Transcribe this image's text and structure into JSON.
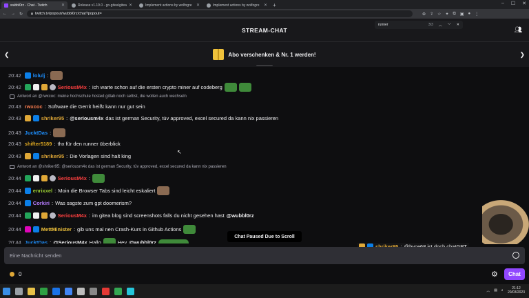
{
  "browser": {
    "tabs": [
      {
        "label": "wubbl0rz - Chat - Twitch",
        "active": true,
        "icon": "twitch-icon"
      },
      {
        "label": "Release v1.19.0 - go-gitea/gitea",
        "active": false,
        "icon": "github-icon"
      },
      {
        "label": "Implement actions by wolfogre",
        "active": false,
        "icon": "github-icon"
      },
      {
        "label": "Implement actions by wolfogre",
        "active": false,
        "icon": "github-icon"
      }
    ],
    "new_tab": "+",
    "url": "twitch.tv/popout/wubbl0rz/chat?popout=",
    "find": {
      "query": "runner",
      "count": "3/3"
    }
  },
  "header": {
    "title": "STREAM-CHAT"
  },
  "promo": {
    "label": "Abo verschenken & Nr. 1 werden!"
  },
  "chat": {
    "messages": [
      {
        "time": "20:42",
        "user": "lolulj",
        "color": "#1e90ff",
        "badges": [
          "b-prime"
        ],
        "text": "",
        "emotes": [
          "e-face"
        ]
      },
      {
        "time": "20:42",
        "user": "SeriousM4x",
        "color": "#ff4040",
        "badges": [
          "b-green",
          "b-crown",
          "b-sub",
          "b-moon"
        ],
        "text": "ich warte schon auf die ersten crypto miner auf codeberg",
        "emotes": [
          "e-frog",
          "e-frog"
        ]
      },
      {
        "reply": "Antwort an @rwxcoc: meine hochschule hosted gitlab noch selbst, die wollen auch wechseln"
      },
      {
        "time": "20:43",
        "user": "rwxcoc",
        "color": "#ff7f50",
        "badges": [],
        "text": "Software die Gerrit heißt kann nur gut sein"
      },
      {
        "time": "20:43",
        "user": "shriker95",
        "color": "#e0a837",
        "badges": [
          "b-sub",
          "b-prime"
        ],
        "text": "das ist german Security, tüv approved, excel secured da kann nix passieren",
        "mention": "@seriousm4x"
      },
      {
        "time": "20:43",
        "user": "JucktDas",
        "color": "#1e90ff",
        "badges": [],
        "text": "",
        "emotes": [
          "e-face"
        ]
      },
      {
        "time": "20:43",
        "user": "shifter5189",
        "color": "#daa520",
        "badges": [],
        "text": "thx für den runner überblick"
      },
      {
        "time": "20:43",
        "user": "shriker95",
        "color": "#e0a837",
        "badges": [
          "b-sub",
          "b-prime"
        ],
        "text": "Die Vorlagen sind halt king"
      },
      {
        "reply": "Antwort an @shriker95: @seriousm4x das ist german Security, tüv approved, excel secured da kann nix passieren"
      },
      {
        "time": "20:44",
        "user": "SeriousM4x",
        "color": "#ff4040",
        "badges": [
          "b-green",
          "b-crown",
          "b-sub",
          "b-moon"
        ],
        "text": "",
        "emotes": [
          "e-frog"
        ]
      },
      {
        "time": "20:44",
        "user": "enrixxel",
        "color": "#9acd32",
        "badges": [
          "b-prime"
        ],
        "text": "Moin die Browser Tabs sind leicht eskaliert",
        "emotes": [
          "e-face"
        ]
      },
      {
        "time": "20:44",
        "user": "Corkiri",
        "color": "#b77cff",
        "badges": [
          "b-prime"
        ],
        "text": "Was sagste zum gpt doomerism?"
      },
      {
        "time": "20:44",
        "user": "SeriousM4x",
        "color": "#ff4040",
        "badges": [
          "b-green",
          "b-crown",
          "b-sub",
          "b-moon"
        ],
        "text": "im gitea blog sind screenshots falls du nicht gesehen hast",
        "mention_after": "@wubbl0rz"
      },
      {
        "time": "20:44",
        "user": "MettMinister",
        "color": "#f0c23b",
        "badges": [
          "b-vip",
          "b-prime"
        ],
        "text": "gib uns mal nen Crash-Kurs in Github Actions",
        "emotes": [
          "e-frog"
        ]
      },
      {
        "time": "20:44",
        "user": "JucktDas",
        "color": "#1e90ff",
        "badges": [],
        "text": "Hallo",
        "mention": "@SeriousM4x",
        "tail": "Hey",
        "mention2": "@wubbl0rz"
      }
    ],
    "paused_label": "Chat Paused Due to Scroll",
    "overlay": {
      "user": "shriker95",
      "color": "#e0a837",
      "text": "@byce68 ist doch chatGPT"
    },
    "input_placeholder": "Eine Nachricht senden",
    "points": "0",
    "chat_button": "Chat"
  },
  "system": {
    "time": "21:12",
    "date": "20/03/2023"
  }
}
